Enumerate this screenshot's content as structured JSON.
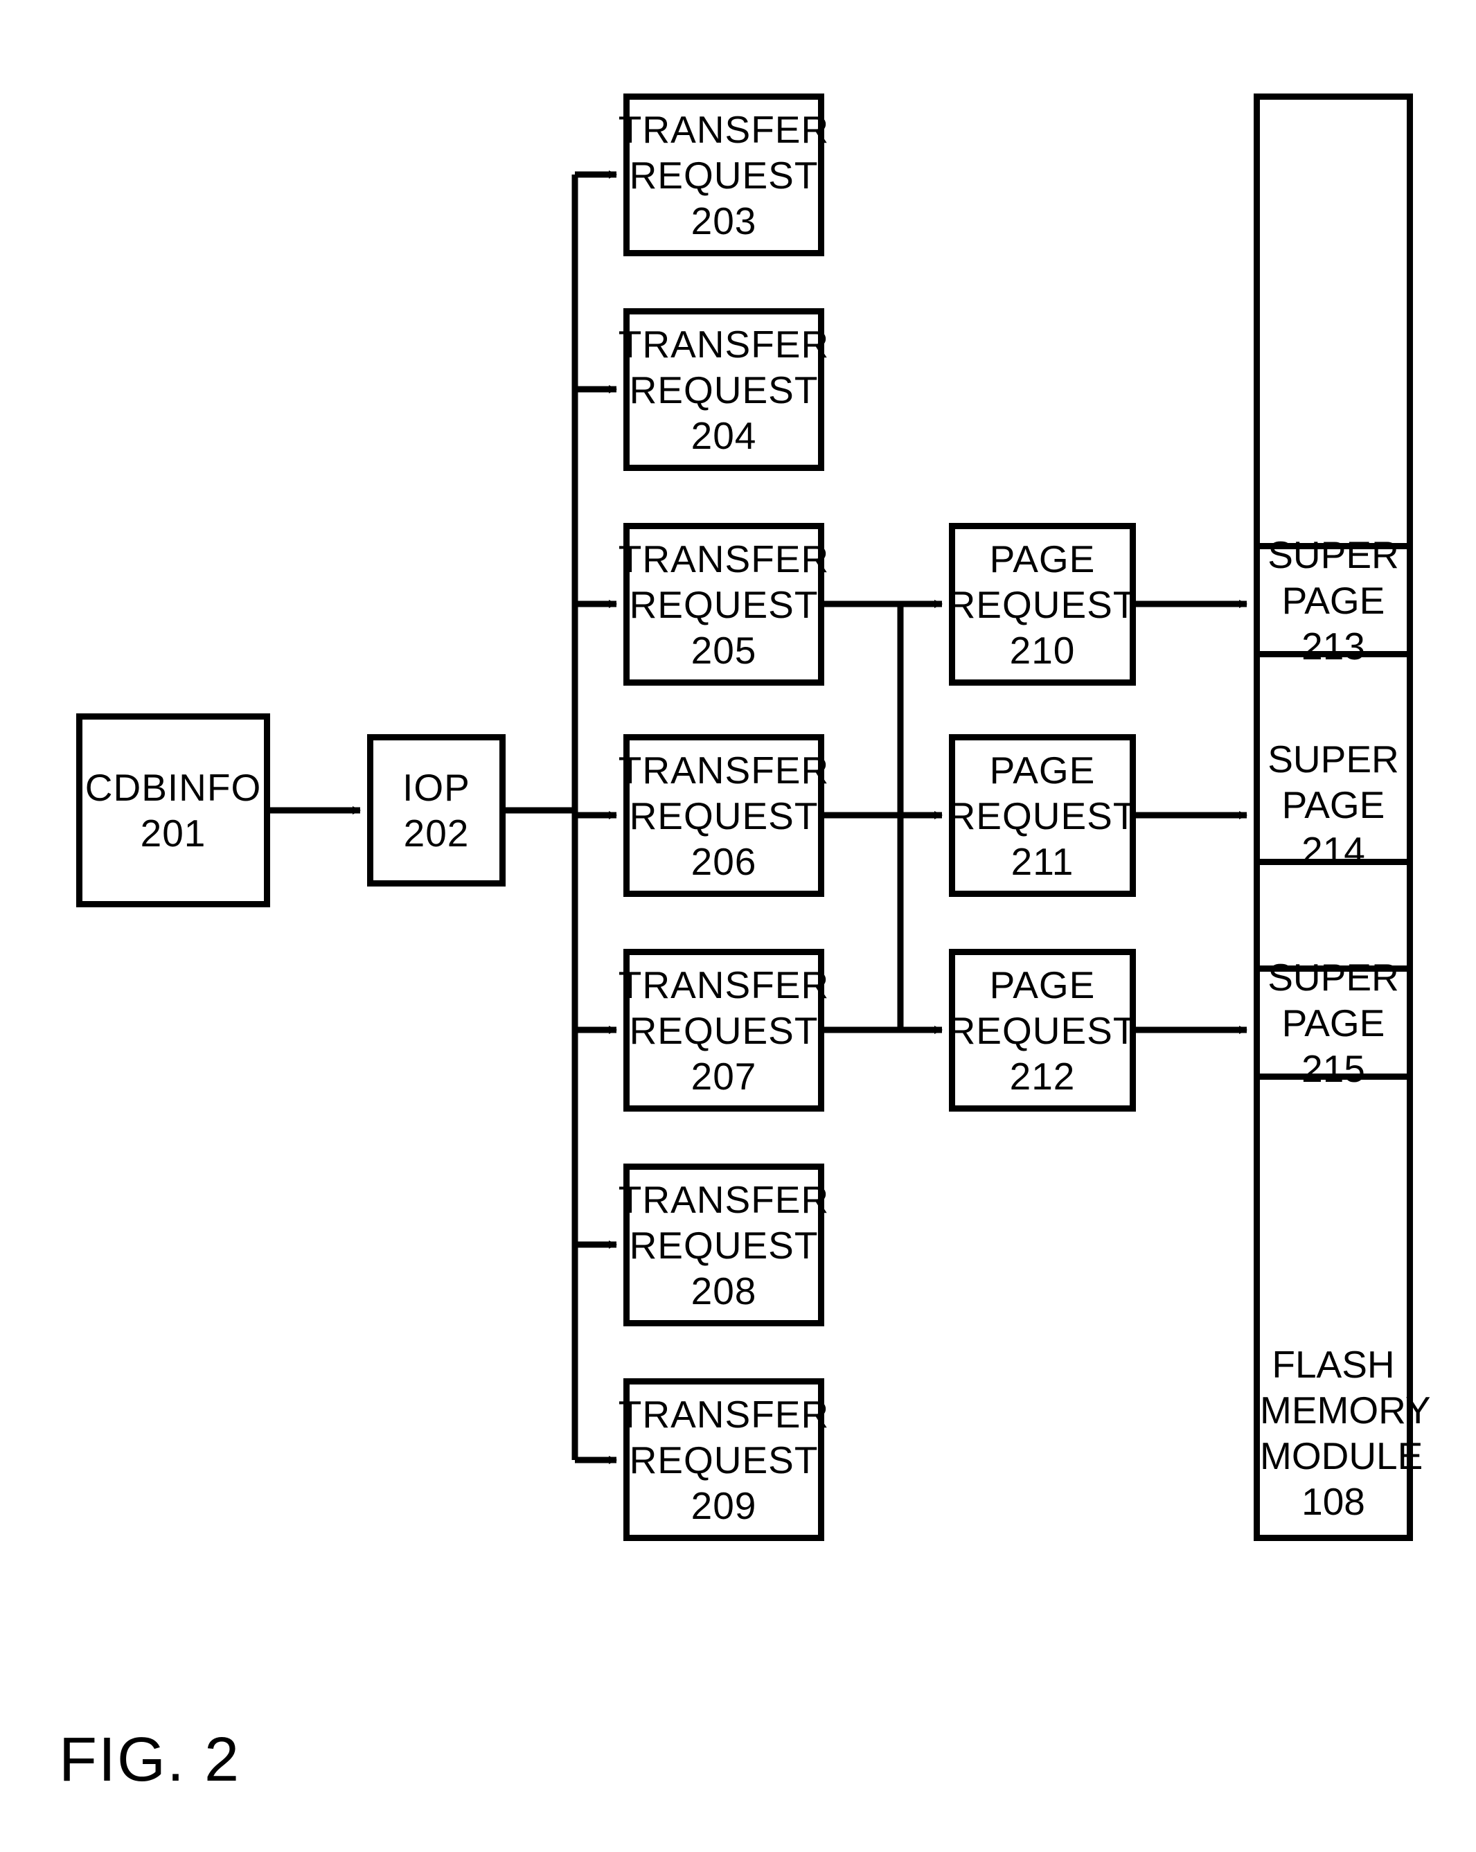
{
  "figure_label": "FIG. 2",
  "cdbinfo": {
    "label": "CDBINFO",
    "num": "201"
  },
  "iop": {
    "label": "IOP",
    "num": "202"
  },
  "transfer": [
    {
      "label": "TRANSFER",
      "sub": "REQUEST",
      "num": "203"
    },
    {
      "label": "TRANSFER",
      "sub": "REQUEST",
      "num": "204"
    },
    {
      "label": "TRANSFER",
      "sub": "REQUEST",
      "num": "205"
    },
    {
      "label": "TRANSFER",
      "sub": "REQUEST",
      "num": "206"
    },
    {
      "label": "TRANSFER",
      "sub": "REQUEST",
      "num": "207"
    },
    {
      "label": "TRANSFER",
      "sub": "REQUEST",
      "num": "208"
    },
    {
      "label": "TRANSFER",
      "sub": "REQUEST",
      "num": "209"
    }
  ],
  "page_req": [
    {
      "label": "PAGE",
      "sub": "REQUEST",
      "num": "210"
    },
    {
      "label": "PAGE",
      "sub": "REQUEST",
      "num": "211"
    },
    {
      "label": "PAGE",
      "sub": "REQUEST",
      "num": "212"
    }
  ],
  "super_page": [
    {
      "label": "SUPER PAGE",
      "num": "213"
    },
    {
      "label": "SUPER PAGE",
      "num": "214"
    },
    {
      "label": "SUPER PAGE",
      "num": "215"
    }
  ],
  "flash": {
    "label1": "FLASH MEMORY",
    "label2": "MODULE 108"
  }
}
